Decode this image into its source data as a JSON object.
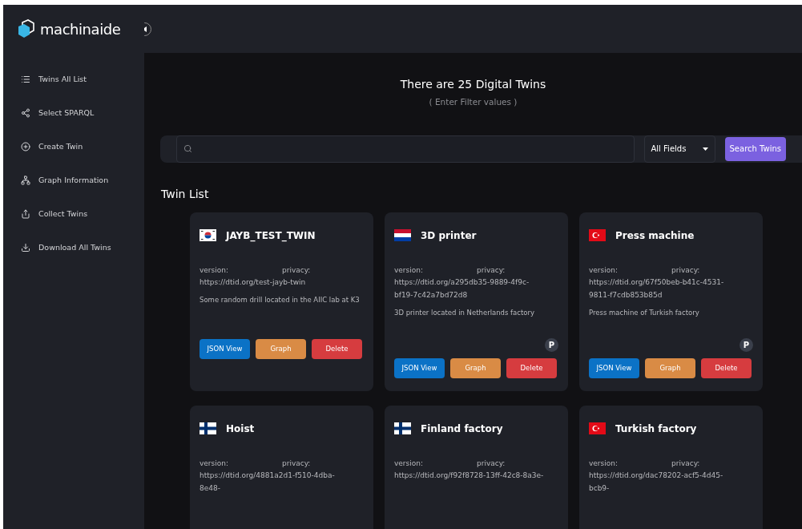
{
  "sidebar": {
    "logo": "machinaide",
    "items": [
      {
        "label": "Twins All List"
      },
      {
        "label": "Select SPARQL"
      },
      {
        "label": "Create Twin"
      },
      {
        "label": "Graph Information"
      },
      {
        "label": "Collect Twins"
      },
      {
        "label": "Download All Twins"
      }
    ]
  },
  "header": {
    "title": "There are 25 Digital Twins",
    "subtitle": "( Enter Filter values )"
  },
  "search": {
    "field_select": "All Fields",
    "button": "Search Twins"
  },
  "twin_list": {
    "title": "Twin List",
    "cards": [
      {
        "name": "JAYB_TEST_TWIN",
        "version_label": "version:",
        "privacy_label": "privacy:",
        "url": "https://dtid.org/test-jayb-twin",
        "description": "Some random drill located in the AIIC lab at K3",
        "buttons": [
          "JSON View",
          "Graph",
          "Delete"
        ]
      },
      {
        "name": "3D printer",
        "version_label": "version:",
        "privacy_label": "privacy:",
        "url": "https://dtid.org/a295db35-9889-4f9c-bf19-7c42a7bd72d8",
        "description": "3D printer located in Netherlands factory",
        "badge": "P",
        "buttons": [
          "JSON View",
          "Graph",
          "Delete"
        ]
      },
      {
        "name": "Press machine",
        "version_label": "version:",
        "privacy_label": "privacy:",
        "url": "https://dtid.org/67f50beb-b41c-4531-9811-f7cdb853b85d",
        "description": "Press machine of Turkish factory",
        "badge": "P",
        "buttons": [
          "JSON View",
          "Graph",
          "Delete"
        ]
      },
      {
        "name": "Hoist",
        "version_label": "version:",
        "privacy_label": "privacy:",
        "url": "https://dtid.org/4881a2d1-f510-4dba-8e48-"
      },
      {
        "name": "Finland factory",
        "version_label": "version:",
        "privacy_label": "privacy:",
        "url": "https://dtid.org/f92f8728-13ff-42c8-8a3e-"
      },
      {
        "name": "Turkish factory",
        "version_label": "version:",
        "privacy_label": "privacy:",
        "url": "https://dtid.org/dac78202-acf5-4d45-bcb9-"
      }
    ]
  }
}
